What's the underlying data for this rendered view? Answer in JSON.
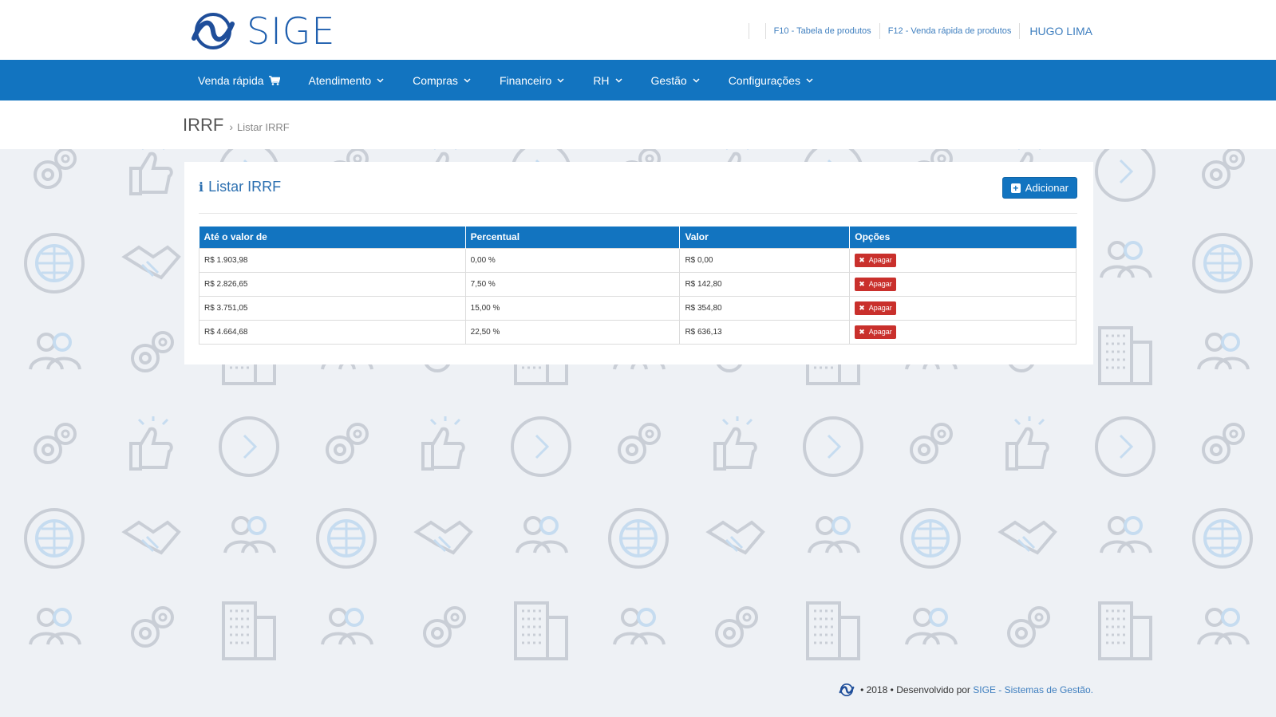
{
  "app": {
    "logo_text": "SIGE",
    "brand_color": "#1274c0"
  },
  "toplinks": {
    "f10": "F10 - Tabela de produtos",
    "f12": "F12 - Venda rápida de produtos",
    "user": "HUGO LIMA"
  },
  "nav": {
    "items": [
      {
        "label": "Venda rápida",
        "icon": "cart-icon"
      },
      {
        "label": "Atendimento",
        "icon": "chevron-down-icon"
      },
      {
        "label": "Compras",
        "icon": "chevron-down-icon"
      },
      {
        "label": "Financeiro",
        "icon": "chevron-down-icon"
      },
      {
        "label": "RH",
        "icon": "chevron-down-icon"
      },
      {
        "label": "Gestão",
        "icon": "chevron-down-icon"
      },
      {
        "label": "Configurações",
        "icon": "chevron-down-icon"
      }
    ]
  },
  "breadcrumb": {
    "title": "IRRF",
    "current": "Listar IRRF"
  },
  "panel": {
    "title": "Listar IRRF",
    "add_label": "Adicionar",
    "columns": [
      "Até o valor de",
      "Percentual",
      "Valor",
      "Opções"
    ],
    "rows": [
      {
        "ate": "R$ 1.903,98",
        "percentual": "0,00 %",
        "valor": "R$ 0,00",
        "action": "Apagar"
      },
      {
        "ate": "R$ 2.826,65",
        "percentual": "7,50 %",
        "valor": "R$ 142,80",
        "action": "Apagar"
      },
      {
        "ate": "R$ 3.751,05",
        "percentual": "15,00 %",
        "valor": "R$ 354,80",
        "action": "Apagar"
      },
      {
        "ate": "R$ 4.664,68",
        "percentual": "22,50 %",
        "valor": "R$ 636,13",
        "action": "Apagar"
      }
    ]
  },
  "footer": {
    "text": "• 2018 • Desenvolvido por",
    "link": "SIGE - Sistemas de Gestão."
  }
}
